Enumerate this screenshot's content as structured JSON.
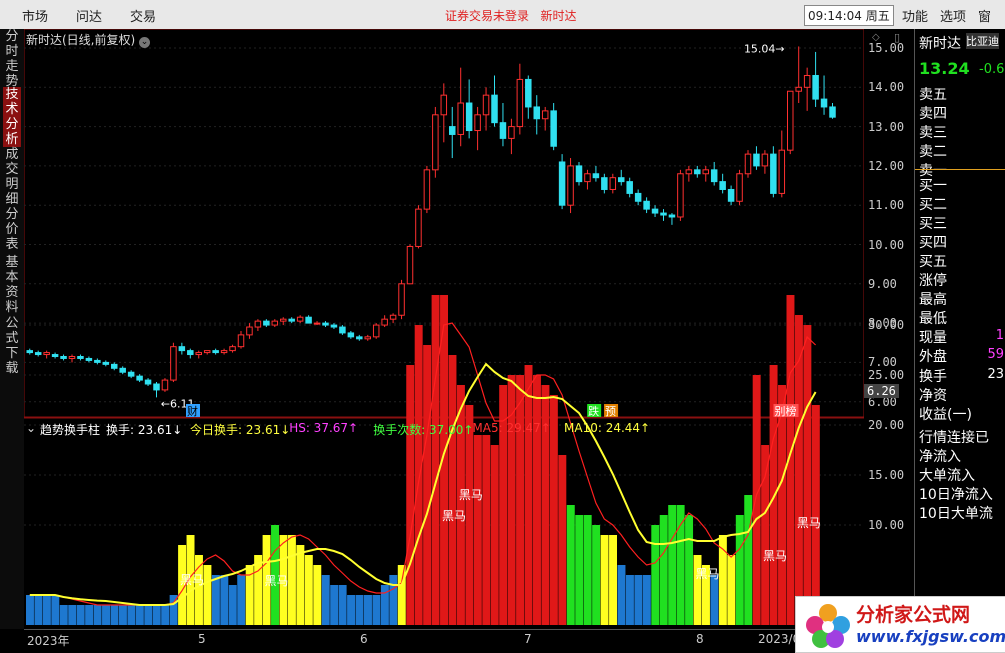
{
  "topbar": {
    "menu": [
      "市场",
      "问达",
      "交易"
    ],
    "status_left": "证券交易未登录",
    "status_right": "新时达",
    "clock": "09:14:04 周五",
    "right_menu": [
      "功能",
      "选项",
      "窗"
    ]
  },
  "sidetabs": [
    {
      "label": "分时走势",
      "active": false
    },
    {
      "label": "技术分析",
      "active": true
    },
    {
      "label": "成交明细",
      "active": false
    },
    {
      "label": "分价表",
      "active": false
    },
    {
      "label": "基本资料",
      "active": false
    },
    {
      "label": "公式下载",
      "active": false
    }
  ],
  "chart_header": {
    "title": "新时达(日线,前复权)"
  },
  "price_axis": {
    "ticks": [
      "15.00",
      "14.00",
      "13.00",
      "12.00",
      "11.00",
      "10.00",
      "9.00",
      "8.00",
      "7.00",
      "6.00"
    ],
    "current": "6.26"
  },
  "vol_axis": {
    "ticks": [
      "30.00",
      "25.00",
      "20.00",
      "15.00",
      "10.00"
    ]
  },
  "annotations": {
    "high": "15.04",
    "low": "6.11",
    "markers": [
      "财",
      "跌",
      "预",
      "别榜"
    ],
    "heima": "黑马"
  },
  "indicator": {
    "name": "趋势换手柱",
    "items": [
      {
        "label": "换手:",
        "value": "23.61",
        "arrow": "↓",
        "color": "#ffffff"
      },
      {
        "label": "今日换手:",
        "value": "23.61",
        "arrow": "↓",
        "color": "#ffff40"
      },
      {
        "label": "HS:",
        "value": "37.67",
        "arrow": "↑",
        "color": "#ff40ff"
      },
      {
        "label": "换手次数:",
        "value": "37.00",
        "arrow": "↑",
        "color": "#40ff40"
      },
      {
        "label": "MA5:",
        "value": "29.47",
        "arrow": "↑",
        "color": "#ff3030"
      },
      {
        "label": "MA10:",
        "value": "24.44",
        "arrow": "↑",
        "color": "#ffff40"
      }
    ]
  },
  "x_axis": [
    "2023年",
    "5",
    "6",
    "7",
    "8",
    "2023/0"
  ],
  "right_panel": {
    "stock": "新时达",
    "tag": "比亚迪",
    "price": "13.24",
    "change": "-0.6",
    "sell": [
      "卖五",
      "卖四",
      "卖三",
      "卖二",
      "卖一"
    ],
    "buy": [
      "买一",
      "买二",
      "买三",
      "买四",
      "买五"
    ],
    "stats": [
      "涨停",
      "最高",
      "最低",
      "现量",
      "外盘"
    ],
    "stat_values": [
      "",
      "",
      "",
      "1",
      "59"
    ],
    "stats2": [
      "换手",
      "净资",
      "收益(一)"
    ],
    "stats2_values": [
      "23",
      "",
      ""
    ],
    "flows": [
      "行情连接已",
      "净流入",
      "大单流入",
      "10日净流入",
      "10日大单流"
    ]
  },
  "logo": {
    "text": "分析家公式网",
    "url": "www.fxjgsw.com"
  },
  "chart_data": {
    "type": "candlestick",
    "title": "新时达(日线,前复权)",
    "candles": [
      [
        7.3,
        7.35,
        7.2,
        7.25
      ],
      [
        7.25,
        7.3,
        7.15,
        7.2
      ],
      [
        7.2,
        7.3,
        7.1,
        7.25
      ],
      [
        7.2,
        7.25,
        7.1,
        7.15
      ],
      [
        7.15,
        7.2,
        7.05,
        7.1
      ],
      [
        7.1,
        7.2,
        7.0,
        7.15
      ],
      [
        7.15,
        7.2,
        7.05,
        7.1
      ],
      [
        7.1,
        7.15,
        7.0,
        7.05
      ],
      [
        7.05,
        7.1,
        6.95,
        7.0
      ],
      [
        7.0,
        7.05,
        6.9,
        6.95
      ],
      [
        6.95,
        7.0,
        6.8,
        6.85
      ],
      [
        6.85,
        6.9,
        6.7,
        6.75
      ],
      [
        6.75,
        6.8,
        6.6,
        6.65
      ],
      [
        6.65,
        6.7,
        6.5,
        6.55
      ],
      [
        6.55,
        6.6,
        6.4,
        6.45
      ],
      [
        6.45,
        6.5,
        6.11,
        6.3
      ],
      [
        6.3,
        6.6,
        6.25,
        6.55
      ],
      [
        6.55,
        7.5,
        6.5,
        7.4
      ],
      [
        7.4,
        7.5,
        7.2,
        7.3
      ],
      [
        7.3,
        7.35,
        7.1,
        7.2
      ],
      [
        7.2,
        7.3,
        7.1,
        7.25
      ],
      [
        7.25,
        7.3,
        7.2,
        7.3
      ],
      [
        7.3,
        7.35,
        7.2,
        7.25
      ],
      [
        7.25,
        7.35,
        7.2,
        7.3
      ],
      [
        7.3,
        7.45,
        7.25,
        7.4
      ],
      [
        7.4,
        7.8,
        7.35,
        7.7
      ],
      [
        7.7,
        8.0,
        7.6,
        7.9
      ],
      [
        7.9,
        8.1,
        7.8,
        8.05
      ],
      [
        8.05,
        8.1,
        7.9,
        7.95
      ],
      [
        7.95,
        8.1,
        7.9,
        8.05
      ],
      [
        8.05,
        8.15,
        7.95,
        8.1
      ],
      [
        8.1,
        8.15,
        8.0,
        8.05
      ],
      [
        8.05,
        8.2,
        8.0,
        8.15
      ],
      [
        8.15,
        8.2,
        8.0,
        8.0
      ],
      [
        8.0,
        8.05,
        7.95,
        8.0
      ],
      [
        8.0,
        8.05,
        7.9,
        7.95
      ],
      [
        7.95,
        8.0,
        7.85,
        7.9
      ],
      [
        7.9,
        7.95,
        7.7,
        7.75
      ],
      [
        7.75,
        7.8,
        7.6,
        7.65
      ],
      [
        7.65,
        7.7,
        7.55,
        7.6
      ],
      [
        7.6,
        7.7,
        7.55,
        7.65
      ],
      [
        7.65,
        8.0,
        7.6,
        7.95
      ],
      [
        7.95,
        8.2,
        7.9,
        8.1
      ],
      [
        8.1,
        8.25,
        8.0,
        8.2
      ],
      [
        8.2,
        9.1,
        8.1,
        9.0
      ],
      [
        9.0,
        10.0,
        9.0,
        9.95
      ],
      [
        9.95,
        11.0,
        9.9,
        10.9
      ],
      [
        10.9,
        12.0,
        10.8,
        11.9
      ],
      [
        11.9,
        13.5,
        11.7,
        13.3
      ],
      [
        13.3,
        14.1,
        12.6,
        13.8
      ],
      [
        13.0,
        13.5,
        12.2,
        12.8
      ],
      [
        12.8,
        14.5,
        12.5,
        13.6
      ],
      [
        13.6,
        14.2,
        12.7,
        12.9
      ],
      [
        12.9,
        13.5,
        12.4,
        13.3
      ],
      [
        13.3,
        14.0,
        12.9,
        13.8
      ],
      [
        13.8,
        14.3,
        13.0,
        13.1
      ],
      [
        13.1,
        13.6,
        12.5,
        12.7
      ],
      [
        12.7,
        13.2,
        12.3,
        13.0
      ],
      [
        13.0,
        14.6,
        12.8,
        14.2
      ],
      [
        14.2,
        14.3,
        13.2,
        13.5
      ],
      [
        13.5,
        13.8,
        12.8,
        13.2
      ],
      [
        13.2,
        13.5,
        12.9,
        13.4
      ],
      [
        13.4,
        13.6,
        12.4,
        12.5
      ],
      [
        12.1,
        12.3,
        10.9,
        11.0
      ],
      [
        11.0,
        12.2,
        10.8,
        12.0
      ],
      [
        12.0,
        12.1,
        11.5,
        11.6
      ],
      [
        11.6,
        11.9,
        11.4,
        11.8
      ],
      [
        11.8,
        12.0,
        11.6,
        11.7
      ],
      [
        11.7,
        11.8,
        11.3,
        11.4
      ],
      [
        11.4,
        11.8,
        11.3,
        11.7
      ],
      [
        11.7,
        11.9,
        11.5,
        11.6
      ],
      [
        11.6,
        11.7,
        11.2,
        11.3
      ],
      [
        11.3,
        11.4,
        11.0,
        11.1
      ],
      [
        11.1,
        11.2,
        10.8,
        10.9
      ],
      [
        10.9,
        11.0,
        10.7,
        10.8
      ],
      [
        10.8,
        10.9,
        10.6,
        10.75
      ],
      [
        10.75,
        10.8,
        10.5,
        10.7
      ],
      [
        10.7,
        11.9,
        10.6,
        11.8
      ],
      [
        11.8,
        12.0,
        11.6,
        11.9
      ],
      [
        11.9,
        12.0,
        11.7,
        11.8
      ],
      [
        11.8,
        12.0,
        11.6,
        11.9
      ],
      [
        11.9,
        12.1,
        11.5,
        11.6
      ],
      [
        11.6,
        11.8,
        11.3,
        11.4
      ],
      [
        11.4,
        11.5,
        11.0,
        11.1
      ],
      [
        11.1,
        11.9,
        11.0,
        11.8
      ],
      [
        11.8,
        12.4,
        11.7,
        12.3
      ],
      [
        12.3,
        12.5,
        11.9,
        12.0
      ],
      [
        12.0,
        12.4,
        11.8,
        12.3
      ],
      [
        12.3,
        12.5,
        11.2,
        11.3
      ],
      [
        11.3,
        12.9,
        11.2,
        12.4
      ],
      [
        12.4,
        13.9,
        12.3,
        13.9
      ],
      [
        13.9,
        15.04,
        13.6,
        14.0
      ],
      [
        14.0,
        14.5,
        13.4,
        14.3
      ],
      [
        14.3,
        14.9,
        13.5,
        13.7
      ],
      [
        13.7,
        14.3,
        13.3,
        13.5
      ],
      [
        13.5,
        13.6,
        13.2,
        13.24
      ]
    ],
    "volume": [
      3,
      3,
      3,
      3,
      2,
      2,
      2,
      2,
      2,
      2,
      2,
      2,
      2,
      2,
      2,
      2,
      2,
      3,
      8,
      9,
      7,
      6,
      5,
      5,
      4,
      5,
      6,
      7,
      9,
      10,
      9,
      9,
      8,
      7,
      6,
      5,
      4,
      4,
      3,
      3,
      3,
      3,
      4,
      5,
      6,
      26,
      30,
      28,
      33,
      33,
      27,
      24,
      22,
      19,
      19,
      18,
      24,
      25,
      25,
      26,
      25,
      24,
      23,
      17,
      12,
      11,
      11,
      10,
      9,
      9,
      6,
      5,
      5,
      5,
      10,
      11,
      12,
      12,
      11,
      7,
      6,
      5,
      9,
      7,
      11,
      13,
      25,
      18,
      26,
      24,
      33,
      31,
      30,
      22
    ]
  },
  "colors": {
    "up": "#ff3030",
    "down": "#30e0f0",
    "ma5": "#ff2020",
    "ma10": "#ffff30"
  }
}
